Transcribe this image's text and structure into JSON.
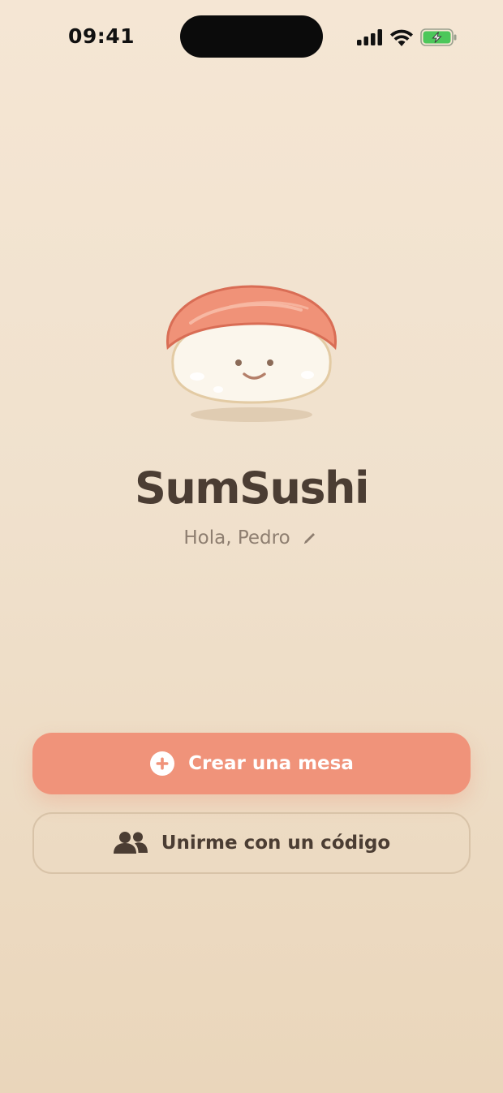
{
  "status_bar": {
    "time": "09:41",
    "icons": [
      "cellular-signal-icon",
      "wifi-icon",
      "battery-charging-icon"
    ]
  },
  "app": {
    "mascot": "sushi-mascot",
    "title": "SumSushi",
    "greeting": "Hola, Pedro",
    "greeting_edit_icon": "pencil-icon"
  },
  "actions": {
    "create_table": {
      "label": "Crear una mesa",
      "icon": "plus-circle-icon"
    },
    "join_with_code": {
      "label": "Unirme con un código",
      "icon": "people-icon"
    }
  },
  "colors": {
    "background_top": "#f5e6d4",
    "background_bottom": "#ead6bb",
    "primary_button": "#f0937a",
    "secondary_border": "#d8c3a8",
    "title_text": "#4b3d33",
    "muted_text": "#8e7e70"
  }
}
